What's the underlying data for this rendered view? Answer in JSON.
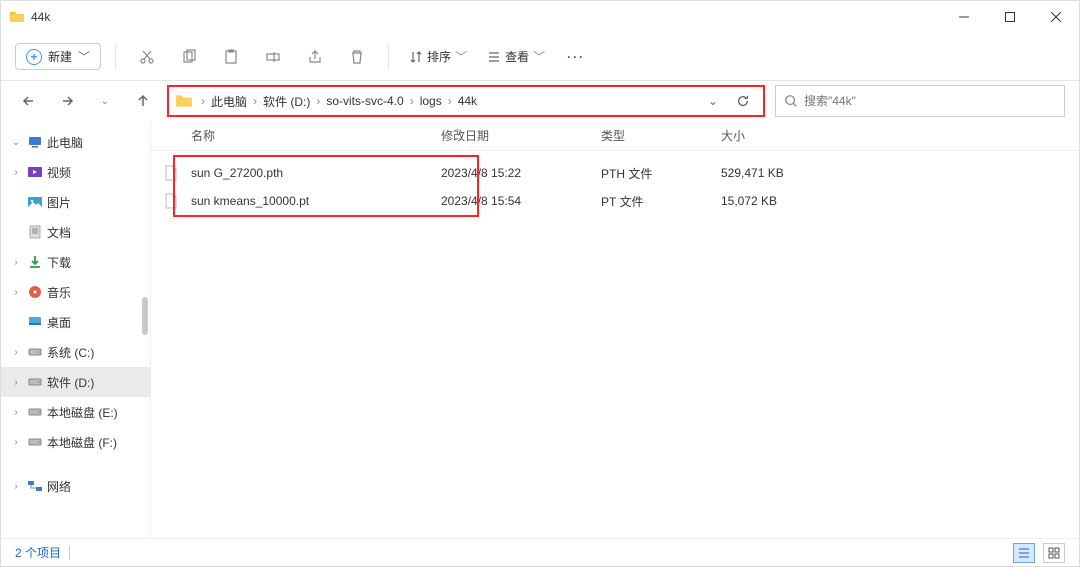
{
  "window": {
    "title": "44k"
  },
  "ribbon": {
    "new_label": "新建",
    "sort_label": "排序",
    "view_label": "查看"
  },
  "breadcrumb": {
    "items": [
      "此电脑",
      "软件 (D:)",
      "so-vits-svc-4.0",
      "logs",
      "44k"
    ]
  },
  "search": {
    "placeholder": "搜索\"44k\""
  },
  "columns": {
    "name": "名称",
    "date": "修改日期",
    "type": "类型",
    "size": "大小"
  },
  "sidebar": {
    "items": [
      {
        "label": "此电脑",
        "chevron": "v",
        "icon": "pc"
      },
      {
        "label": "视频",
        "chevron": ">",
        "icon": "video"
      },
      {
        "label": "图片",
        "chevron": "",
        "icon": "pic"
      },
      {
        "label": "文档",
        "chevron": "",
        "icon": "doc"
      },
      {
        "label": "下载",
        "chevron": ">",
        "icon": "dl"
      },
      {
        "label": "音乐",
        "chevron": ">",
        "icon": "music"
      },
      {
        "label": "桌面",
        "chevron": "",
        "icon": "desk"
      },
      {
        "label": "系统 (C:)",
        "chevron": ">",
        "icon": "drive"
      },
      {
        "label": "软件 (D:)",
        "chevron": ">",
        "icon": "drive",
        "selected": true
      },
      {
        "label": "本地磁盘 (E:)",
        "chevron": ">",
        "icon": "drive"
      },
      {
        "label": "本地磁盘 (F:)",
        "chevron": ">",
        "icon": "drive"
      },
      {
        "label": "网络",
        "chevron": ">",
        "icon": "net",
        "gap": true
      }
    ]
  },
  "files": [
    {
      "name": "sun G_27200.pth",
      "date": "2023/4/8 15:22",
      "type": "PTH 文件",
      "size": "529,471 KB"
    },
    {
      "name": "sun kmeans_10000.pt",
      "date": "2023/4/8 15:54",
      "type": "PT 文件",
      "size": "15,072 KB"
    }
  ],
  "status": {
    "count_label": "2 个项目"
  }
}
